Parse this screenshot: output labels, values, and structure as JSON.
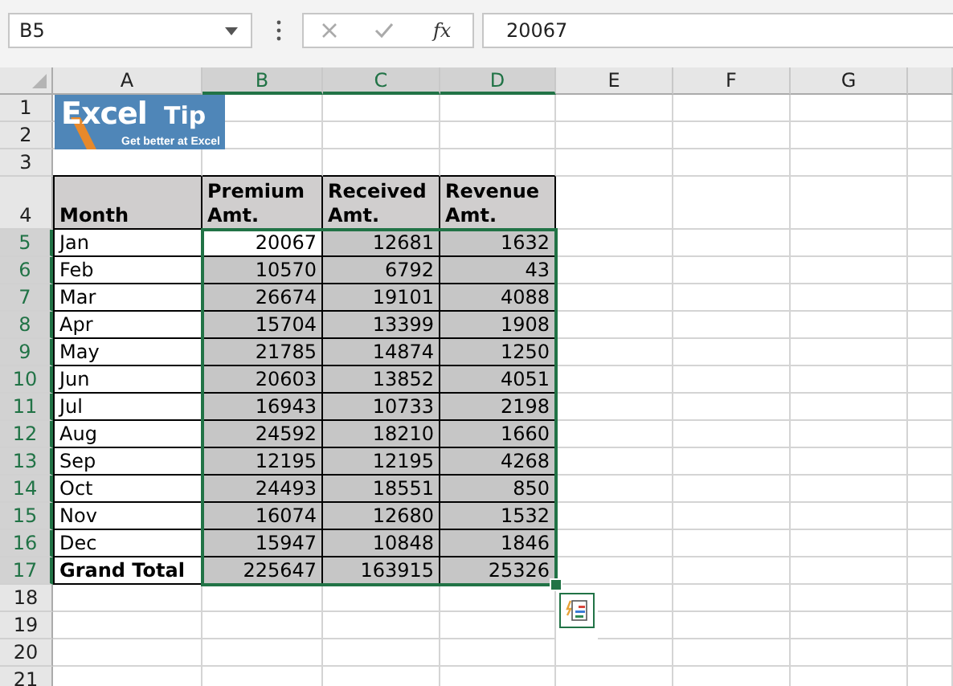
{
  "formula_bar": {
    "name_box": "B5",
    "function_label": "fx",
    "value": "20067"
  },
  "columns": [
    {
      "label": "A",
      "selected": false
    },
    {
      "label": "B",
      "selected": true
    },
    {
      "label": "C",
      "selected": true
    },
    {
      "label": "D",
      "selected": true
    },
    {
      "label": "E",
      "selected": false
    },
    {
      "label": "F",
      "selected": false
    },
    {
      "label": "G",
      "selected": false
    },
    {
      "selected": false
    }
  ],
  "logo": {
    "title": "Excel",
    "accent": "Tip",
    "tagline": "Get better at Excel"
  },
  "rows": [
    {
      "label": "1",
      "selected": false,
      "kind": "empty",
      "cells": []
    },
    {
      "label": "2",
      "selected": false,
      "kind": "empty",
      "cells": []
    },
    {
      "label": "3",
      "selected": false,
      "kind": "empty",
      "cells": []
    },
    {
      "label": "4",
      "selected": false,
      "kind": "header",
      "cells": [
        {
          "text": "Month",
          "selected": false
        },
        {
          "text": "Premium Amt.",
          "selected": false
        },
        {
          "text": "Received Amt.",
          "selected": false
        },
        {
          "text": "Revenue Amt.",
          "selected": false
        }
      ]
    },
    {
      "label": "5",
      "selected": true,
      "kind": "data",
      "cells": [
        {
          "text": "Jan",
          "selected": false
        },
        {
          "text": "20067",
          "selected": false
        },
        {
          "text": "12681",
          "selected": true
        },
        {
          "text": "1632",
          "selected": true
        }
      ]
    },
    {
      "label": "6",
      "selected": true,
      "kind": "data",
      "cells": [
        {
          "text": "Feb",
          "selected": false
        },
        {
          "text": "10570",
          "selected": true
        },
        {
          "text": "6792",
          "selected": true
        },
        {
          "text": "43",
          "selected": true
        }
      ]
    },
    {
      "label": "7",
      "selected": true,
      "kind": "data",
      "cells": [
        {
          "text": "Mar",
          "selected": false
        },
        {
          "text": "26674",
          "selected": true
        },
        {
          "text": "19101",
          "selected": true
        },
        {
          "text": "4088",
          "selected": true
        }
      ]
    },
    {
      "label": "8",
      "selected": true,
      "kind": "data",
      "cells": [
        {
          "text": "Apr",
          "selected": false
        },
        {
          "text": "15704",
          "selected": true
        },
        {
          "text": "13399",
          "selected": true
        },
        {
          "text": "1908",
          "selected": true
        }
      ]
    },
    {
      "label": "9",
      "selected": true,
      "kind": "data",
      "cells": [
        {
          "text": "May",
          "selected": false
        },
        {
          "text": "21785",
          "selected": true
        },
        {
          "text": "14874",
          "selected": true
        },
        {
          "text": "1250",
          "selected": true
        }
      ]
    },
    {
      "label": "10",
      "selected": true,
      "kind": "data",
      "cells": [
        {
          "text": "Jun",
          "selected": false
        },
        {
          "text": "20603",
          "selected": true
        },
        {
          "text": "13852",
          "selected": true
        },
        {
          "text": "4051",
          "selected": true
        }
      ]
    },
    {
      "label": "11",
      "selected": true,
      "kind": "data",
      "cells": [
        {
          "text": "Jul",
          "selected": false
        },
        {
          "text": "16943",
          "selected": true
        },
        {
          "text": "10733",
          "selected": true
        },
        {
          "text": "2198",
          "selected": true
        }
      ]
    },
    {
      "label": "12",
      "selected": true,
      "kind": "data",
      "cells": [
        {
          "text": "Aug",
          "selected": false
        },
        {
          "text": "24592",
          "selected": true
        },
        {
          "text": "18210",
          "selected": true
        },
        {
          "text": "1660",
          "selected": true
        }
      ]
    },
    {
      "label": "13",
      "selected": true,
      "kind": "data",
      "cells": [
        {
          "text": "Sep",
          "selected": false
        },
        {
          "text": "12195",
          "selected": true
        },
        {
          "text": "12195",
          "selected": true
        },
        {
          "text": "4268",
          "selected": true
        }
      ]
    },
    {
      "label": "14",
      "selected": true,
      "kind": "data",
      "cells": [
        {
          "text": "Oct",
          "selected": false
        },
        {
          "text": "24493",
          "selected": true
        },
        {
          "text": "18551",
          "selected": true
        },
        {
          "text": "850",
          "selected": true
        }
      ]
    },
    {
      "label": "15",
      "selected": true,
      "kind": "data",
      "cells": [
        {
          "text": "Nov",
          "selected": false
        },
        {
          "text": "16074",
          "selected": true
        },
        {
          "text": "12680",
          "selected": true
        },
        {
          "text": "1532",
          "selected": true
        }
      ]
    },
    {
      "label": "16",
      "selected": true,
      "kind": "data",
      "cells": [
        {
          "text": "Dec",
          "selected": false
        },
        {
          "text": "15947",
          "selected": true
        },
        {
          "text": "10848",
          "selected": true
        },
        {
          "text": "1846",
          "selected": true
        }
      ]
    },
    {
      "label": "17",
      "selected": true,
      "kind": "total",
      "cells": [
        {
          "text": "Grand Total",
          "selected": false
        },
        {
          "text": "225647",
          "selected": true
        },
        {
          "text": "163915",
          "selected": true
        },
        {
          "text": "25326",
          "selected": true
        }
      ]
    },
    {
      "label": "18",
      "selected": false,
      "kind": "empty",
      "cells": []
    },
    {
      "label": "19",
      "selected": false,
      "kind": "empty",
      "cells": []
    },
    {
      "label": "20",
      "selected": false,
      "kind": "empty",
      "cells": []
    },
    {
      "label": "21",
      "selected": false,
      "kind": "empty",
      "cells": []
    }
  ]
}
